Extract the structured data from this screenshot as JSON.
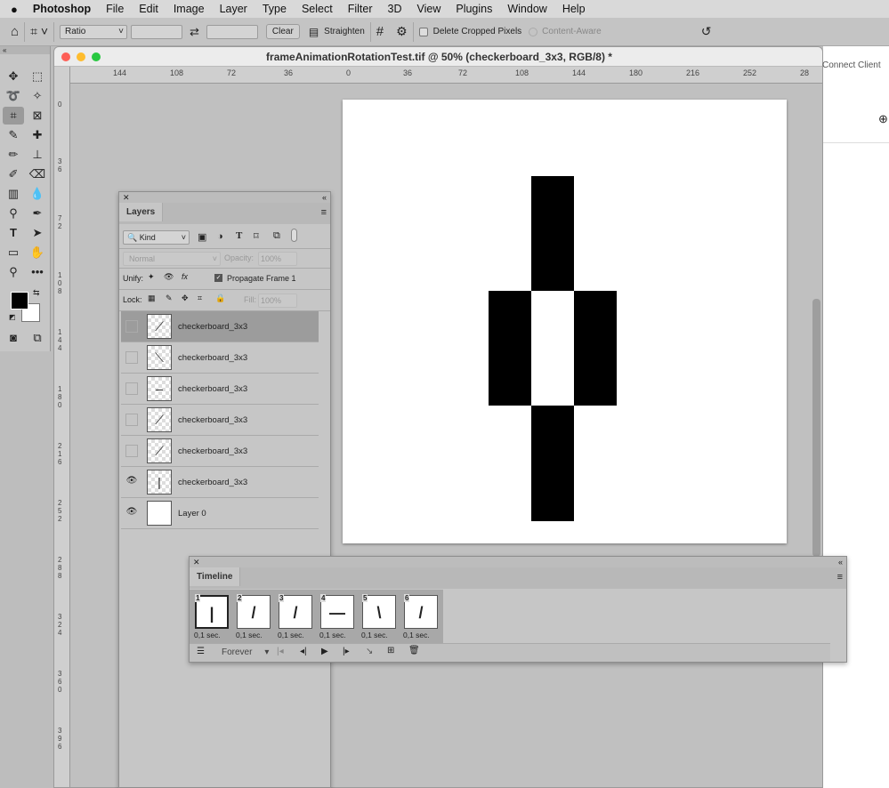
{
  "menubar": {
    "apple": "",
    "items": [
      "Photoshop",
      "File",
      "Edit",
      "Image",
      "Layer",
      "Type",
      "Select",
      "Filter",
      "3D",
      "View",
      "Plugins",
      "Window",
      "Help"
    ]
  },
  "options": {
    "ratio": "Ratio",
    "clear": "Clear",
    "straighten": "Straighten",
    "delete_cropped": "Delete Cropped Pixels",
    "content_aware": "Content-Aware",
    "delete_cropped_checked": false
  },
  "document": {
    "title": "frameAnimationRotationTest.tif @ 50% (checkerboard_3x3, RGB/8) *",
    "hruler": [
      "144",
      "108",
      "72",
      "36",
      "0",
      "36",
      "72",
      "108",
      "144",
      "180",
      "216",
      "252",
      "28"
    ],
    "vruler": [
      "0",
      "3 6",
      "7 2",
      "1 0 8",
      "1 4 4",
      "1 8 0",
      "2 1 6",
      "2 5 2",
      "2 8 8",
      "3 2 4",
      "3 6 0",
      "3 9 6"
    ]
  },
  "right_panel": {
    "connect": "Connect Client"
  },
  "layers": {
    "tab": "Layers",
    "filter": "Kind",
    "blend": "Normal",
    "opacity_label": "Opacity:",
    "opacity": "100%",
    "unify_label": "Unify:",
    "propagate": "Propagate Frame 1",
    "propagate_checked": true,
    "lock_label": "Lock:",
    "fill_label": "Fill:",
    "fill": "100%",
    "items": [
      {
        "name": "checkerboard_3x3",
        "visible": false,
        "selected": true,
        "glyph": "⟋"
      },
      {
        "name": "checkerboard_3x3",
        "visible": false,
        "glyph": "⟍"
      },
      {
        "name": "checkerboard_3x3",
        "visible": false,
        "glyph": "–"
      },
      {
        "name": "checkerboard_3x3",
        "visible": false,
        "glyph": "⟋"
      },
      {
        "name": "checkerboard_3x3",
        "visible": false,
        "glyph": "⟋"
      },
      {
        "name": "checkerboard_3x3",
        "visible": true,
        "glyph": "|"
      },
      {
        "name": "Layer 0",
        "visible": true,
        "glyph": ""
      }
    ]
  },
  "timeline": {
    "tab": "Timeline",
    "loop": "Forever",
    "frames": [
      {
        "n": "1",
        "delay": "0,1 sec.",
        "glyph": "|"
      },
      {
        "n": "2",
        "delay": "0,1 sec.",
        "glyph": "/"
      },
      {
        "n": "3",
        "delay": "0,1 sec.",
        "glyph": "/"
      },
      {
        "n": "4",
        "delay": "0,1 sec.",
        "glyph": "—"
      },
      {
        "n": "5",
        "delay": "0,1 sec.",
        "glyph": "\\"
      },
      {
        "n": "6",
        "delay": "0,1 sec.",
        "glyph": "/"
      }
    ]
  },
  "colors": {
    "foreground": "#000000",
    "background": "#ffffff"
  }
}
